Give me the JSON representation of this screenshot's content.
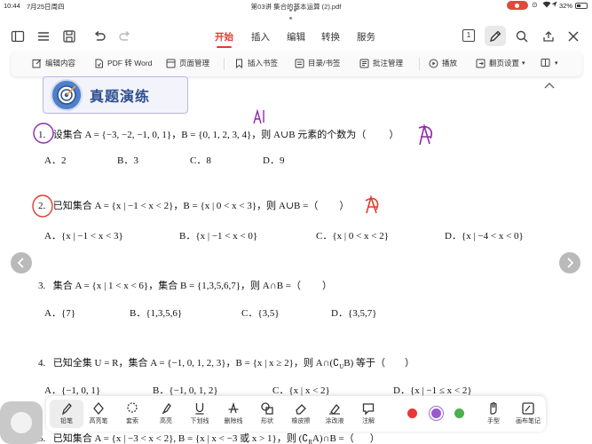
{
  "status": {
    "time": "10:44",
    "date": "7月25日周四",
    "doc_title": "第03讲 集合的基本运算 (2).pdf",
    "battery": "32%"
  },
  "topbar": {
    "tabs": [
      "开始",
      "插入",
      "编辑",
      "转换",
      "服务"
    ],
    "active_tab": "开始",
    "page_indicator": "1"
  },
  "subbar": {
    "items": [
      "编辑内容",
      "PDF 转 Word",
      "页面管理",
      "插入书签",
      "目录/书签",
      "批注管理",
      "播放",
      "翻页设置"
    ]
  },
  "document": {
    "banner_title": "真题演练",
    "questions": [
      {
        "num": "1.",
        "stem": "设集合 A = {−3, −2, −1, 0, 1}，B = {0, 1, 2, 3, 4}，则 A∪B 元素的个数为（",
        "close": "）",
        "options": [
          "A．2",
          "B．3",
          "C．8",
          "D．9"
        ]
      },
      {
        "num": "2.",
        "stem": "已知集合 A = {x | −1 < x < 2}，B = {x | 0 < x < 3}，则 A∪B =（",
        "close": "）",
        "options": [
          "A．{x | −1 < x < 3}",
          "B．{x | −1 < x < 0}",
          "C．{x | 0 < x < 2}",
          "D．{x | −4 < x < 0}"
        ]
      },
      {
        "num": "3.",
        "stem": "集合 A = {x | 1 < x < 6}，集合 B = {1,3,5,6,7}，则 A∩B =（",
        "close": "）",
        "options": [
          "A．{7}",
          "B．{1,3,5,6}",
          "C．{3,5}",
          "D．{3,5,7}"
        ]
      },
      {
        "num": "4.",
        "stem": "已知全集 U = R，集合 A = {−1, 0, 1, 2, 3}，B = {x | x ≥ 2}，则 A∩(∁",
        "stem_tail": "B) 等于（",
        "close": "）",
        "options": [
          "A．{−1, 0, 1}",
          "B．{−1, 0, 1, 2}",
          "C．{x | x < 2}",
          "D．{x | −1 ≤ x < 2}"
        ]
      },
      {
        "num": "5.",
        "stem": "已知集合 A = {x | −3 < x < 2}, B = {x | x < −3 或 x > 1}，则 (∁",
        "stem_tail": "A)∩B =（",
        "close": "）"
      }
    ],
    "handwriting": {
      "answer_1": "A",
      "answer_2": "A",
      "note_top": "A"
    }
  },
  "pentools": {
    "tools": [
      "铅笔",
      "高亮笔",
      "套索",
      "高亮",
      "下划线",
      "删除线",
      "形状",
      "橡皮擦",
      "涂改液",
      "注解"
    ],
    "active_tool": "铅笔",
    "colors": [
      "#e5393b",
      "#9b59d0",
      "#4caf50"
    ],
    "selected_color": "#9b59d0",
    "extra": [
      "手型",
      "画布笔记"
    ]
  }
}
